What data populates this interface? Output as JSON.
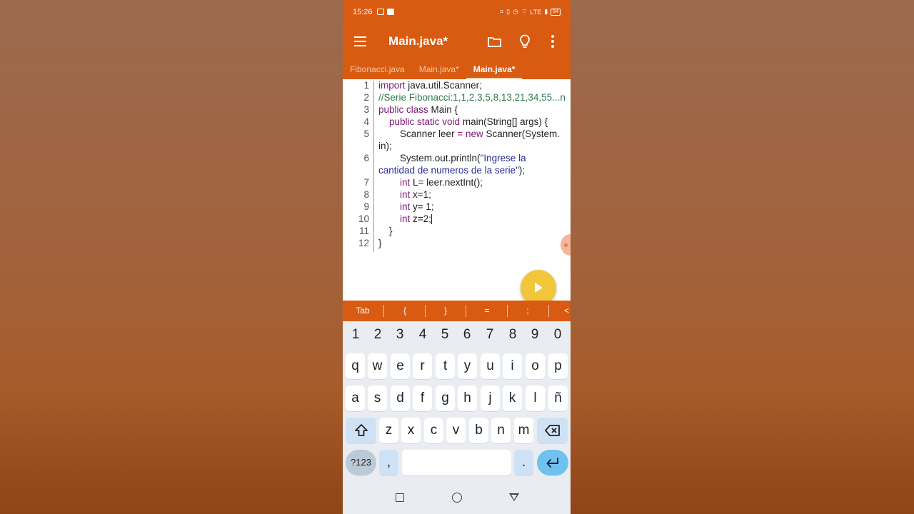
{
  "colors": {
    "accent": "#d95b12",
    "keyword": "#7a1a78",
    "comment": "#2e7d4f",
    "string": "#2a2a9a",
    "fab": "#f2c63b"
  },
  "status_bar": {
    "time": "15:26",
    "network": "LTE",
    "battery": "54"
  },
  "app_bar": {
    "title": "Main.java*",
    "icons": [
      "menu-icon",
      "folder-icon",
      "lightbulb-icon",
      "more-vert-icon"
    ]
  },
  "tabs": [
    {
      "label": "Fibonacci.java",
      "active": false
    },
    {
      "label": "Main.java*",
      "active": false
    },
    {
      "label": "Main.java*",
      "active": true
    }
  ],
  "editor": {
    "line_numbers": [
      "1",
      "2",
      "3",
      "4",
      "5",
      "",
      "6",
      "",
      "7",
      "8",
      "9",
      "10",
      "11",
      "12"
    ],
    "lines": {
      "l1a": "import",
      "l1b": " java.util.Scanner;",
      "l2": "//Serie Fibonacci:1,1,2,3,5,8,13,21,34,55...n",
      "l3a": "public class",
      "l3b": " Main {",
      "l4pad": "    ",
      "l4a": "public static void",
      "l4b": " main(String[] args) {",
      "l5pad": "        ",
      "l5a": "Scanner leer ",
      "l5b": "=",
      "l5c": " ",
      "l5d": "new",
      "l5e": " Scanner(System.",
      "l5w": "in);",
      "l6pad": "        ",
      "l6a": "System.out.println(",
      "l6b": "\"Ingrese la",
      "l6w": "cantidad de numeros de la serie\"",
      "l6wc": ");",
      "l7pad": "        ",
      "l7a": "int",
      "l7b": " L= leer.nextInt();",
      "l8pad": "        ",
      "l8a": "int",
      "l8b": " x=1;",
      "l9pad": "        ",
      "l9a": "int",
      "l9b": " y= 1;",
      "l10pad": "        ",
      "l10a": "int",
      "l10b": " z=2;",
      "l11": "    }",
      "l12": "}"
    }
  },
  "symbol_bar": [
    "Tab",
    "{",
    "}",
    "=",
    ";",
    "<"
  ],
  "keyboard": {
    "numbers": [
      "1",
      "2",
      "3",
      "4",
      "5",
      "6",
      "7",
      "8",
      "9",
      "0"
    ],
    "row1": [
      "q",
      "w",
      "e",
      "r",
      "t",
      "y",
      "u",
      "i",
      "o",
      "p"
    ],
    "row2": [
      "a",
      "s",
      "d",
      "f",
      "g",
      "h",
      "j",
      "k",
      "l",
      "ñ"
    ],
    "row3": [
      "z",
      "x",
      "c",
      "v",
      "b",
      "n",
      "m"
    ],
    "symbols_key": "?123",
    "comma_key": ",",
    "period_key": "."
  }
}
